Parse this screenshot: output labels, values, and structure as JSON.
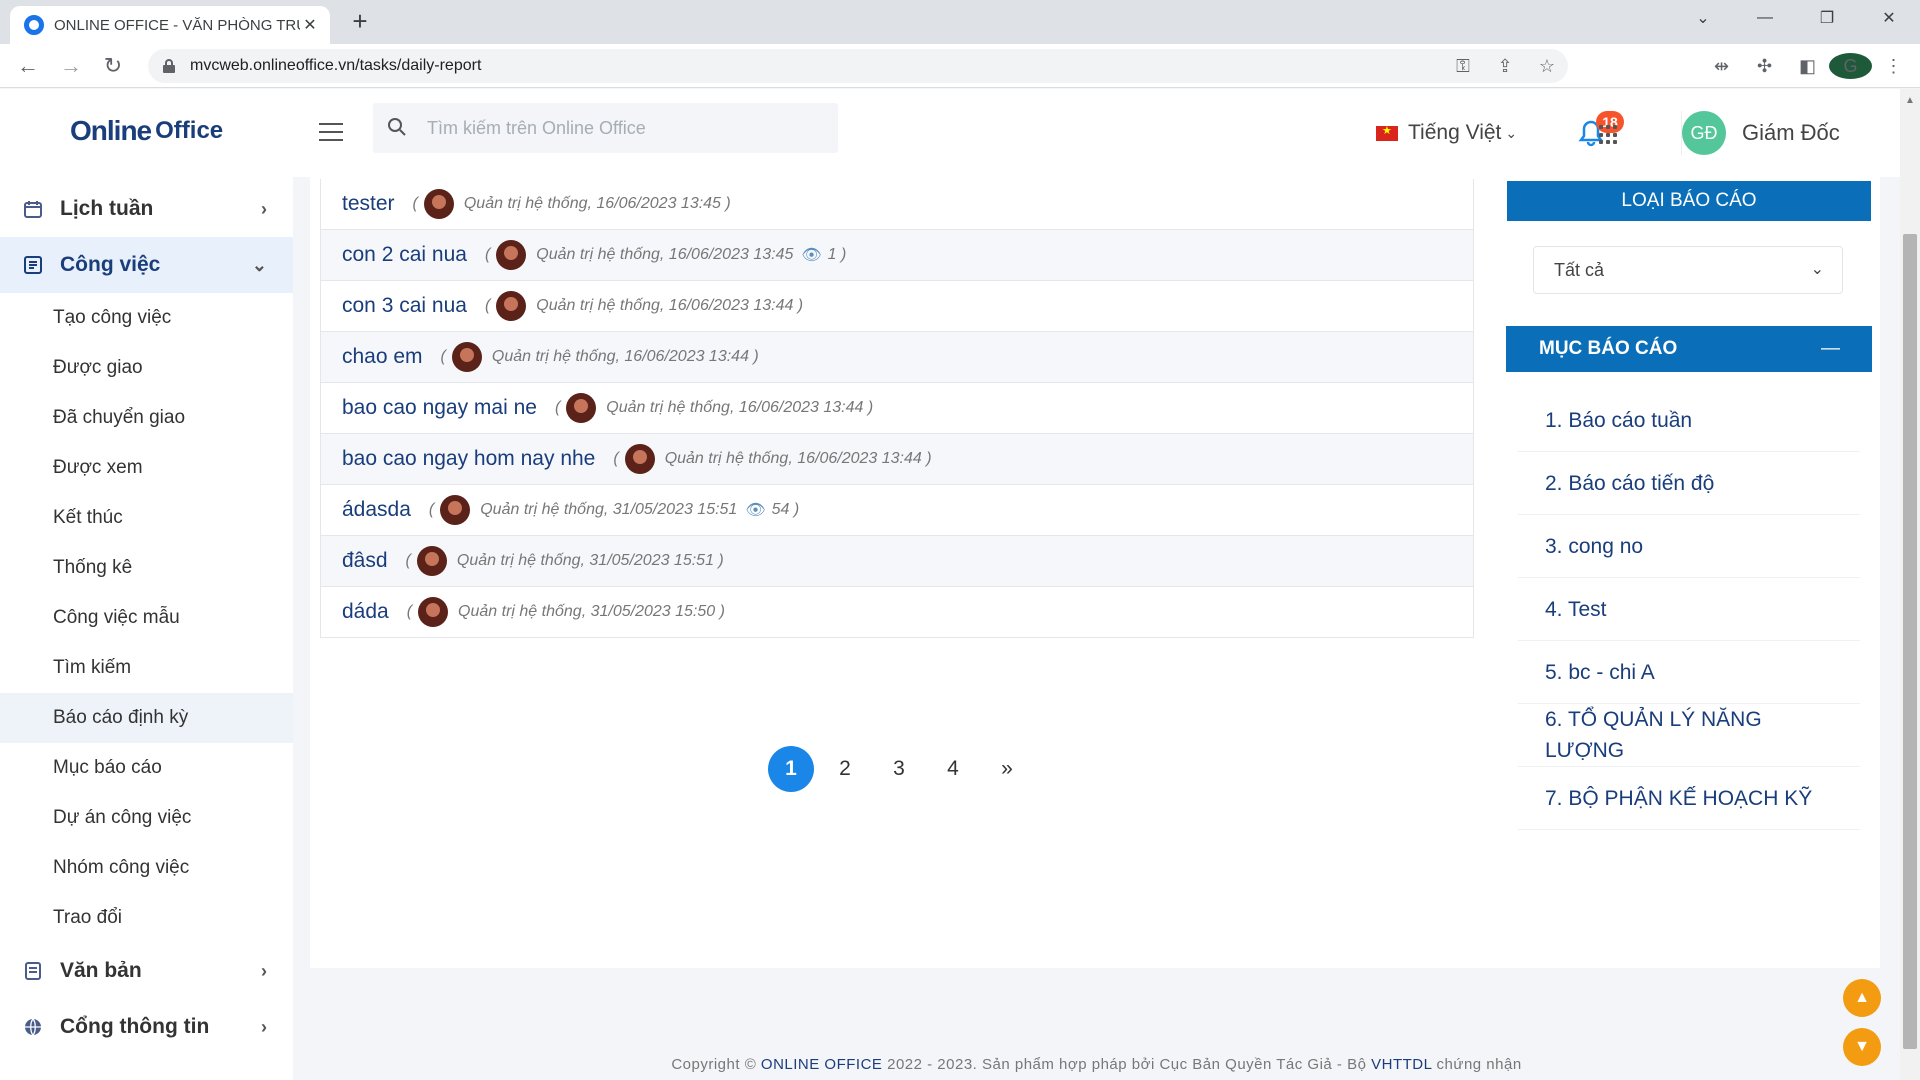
{
  "browser": {
    "tab_title": "ONLINE OFFICE - VĂN PHÒNG TRỰC TUYẾN",
    "url": "mvcweb.onlineoffice.vn/tasks/daily-report",
    "profile_initial": "G"
  },
  "header": {
    "logo_text": "Online",
    "logo_sub": "Office",
    "search_placeholder": "Tìm kiếm trên Online Office",
    "language": "Tiếng Việt",
    "notification_count": "18",
    "user_initials": "GĐ",
    "user_name": "Giám Đốc"
  },
  "sidebar": {
    "lich_tuan": "Lịch tuần",
    "cong_viec": "Công việc",
    "sub_items": [
      "Tạo công việc",
      "Được giao",
      "Đã chuyển giao",
      "Được xem",
      "Kết thúc",
      "Thống kê",
      "Công việc mẫu",
      "Tìm kiếm",
      "Báo cáo định kỳ",
      "Mục báo cáo",
      "Dự án công việc",
      "Nhóm công việc",
      "Trao đổi"
    ],
    "van_ban": "Văn bản",
    "cong_thong_tin": "Cổng thông tin"
  },
  "reports": [
    {
      "title": "tester",
      "meta": "Quản trị hệ thống, 16/06/2023 13:45",
      "views": ""
    },
    {
      "title": "con 2 cai nua",
      "meta": "Quản trị hệ thống, 16/06/2023 13:45",
      "views": "1"
    },
    {
      "title": "con 3 cai nua",
      "meta": "Quản trị hệ thống, 16/06/2023 13:44",
      "views": ""
    },
    {
      "title": "chao em",
      "meta": "Quản trị hệ thống, 16/06/2023 13:44",
      "views": ""
    },
    {
      "title": "bao cao ngay mai ne",
      "meta": "Quản trị hệ thống, 16/06/2023 13:44",
      "views": ""
    },
    {
      "title": "bao cao ngay hom nay nhe",
      "meta": "Quản trị hệ thống, 16/06/2023 13:44",
      "views": ""
    },
    {
      "title": "ádasda",
      "meta": "Quản trị hệ thống, 31/05/2023 15:51",
      "views": "54"
    },
    {
      "title": "đâsd",
      "meta": "Quản trị hệ thống, 31/05/2023 15:51",
      "views": ""
    },
    {
      "title": "dáda",
      "meta": "Quản trị hệ thống, 31/05/2023 15:50",
      "views": ""
    }
  ],
  "pagination": {
    "pages": [
      "1",
      "2",
      "3",
      "4"
    ],
    "current": "1",
    "next": "»"
  },
  "right_panel": {
    "loai_bao_cao": "LOẠI BÁO CÁO",
    "select_value": "Tất cả",
    "muc_bao_cao": "MỤC BÁO CÁO",
    "collapse_symbol": "—",
    "items": [
      "1. Báo cáo tuần",
      "2. Báo cáo tiến độ",
      "3. cong no",
      "4. Test",
      "5. bc - chi A",
      "6. TỔ QUẢN LÝ NĂNG LƯỢNG",
      "7. BỘ PHẬN KẾ HOẠCH KỸ"
    ]
  },
  "footer": {
    "prefix": "Copyright © ",
    "brand": "ONLINE OFFICE",
    "middle": " 2022 - 2023. Sản phẩm hợp pháp bởi Cục Bản Quyền Tác Giả - Bộ ",
    "ministry": "VHTTDL",
    "suffix": " chứng nhận"
  },
  "colors": {
    "primary": "#0a6fb8",
    "accent": "#1a86e8",
    "brand_text": "#1a3d7c",
    "scroll_button": "#f39c12"
  }
}
